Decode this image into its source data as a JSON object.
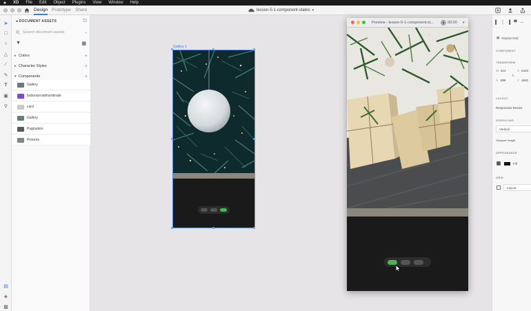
{
  "menubar": {
    "app": "XD",
    "items": [
      "File",
      "Edit",
      "Object",
      "Plugins",
      "View",
      "Window",
      "Help"
    ]
  },
  "titlebar": {
    "tabs": [
      "Design",
      "Prototype",
      "Share"
    ],
    "active_tab": "Design",
    "document_title": "lesson-5-1-component-states"
  },
  "assets": {
    "header": "DOCUMENT ASSETS",
    "search_placeholder": "Search document assets",
    "sections": [
      "Colors",
      "Character Styles",
      "Components"
    ],
    "components": [
      {
        "label": "Gallery",
        "thumb": "#6b7a74"
      },
      {
        "label": "buttonarrowthumbnale",
        "thumb": "#7b4bd6"
      },
      {
        "label": "card",
        "thumb": "#c9c9c9"
      },
      {
        "label": "Gallery",
        "thumb": "#6b7a74"
      },
      {
        "label": "Pagination",
        "thumb": "#5a5a5a"
      },
      {
        "label": "Pictures",
        "thumb": "#7d8784"
      }
    ]
  },
  "canvas": {
    "artboard_label": "Gallery 1"
  },
  "preview": {
    "title": "Preview - lesson-5-1-component-st...",
    "time": "00:00"
  },
  "props": {
    "repeat_grid": "Repeat Grid",
    "component_label": "COMPONENT",
    "transform_label": "TRANSFORM",
    "w": "414",
    "x": "5423",
    "h": "896",
    "y": "1840",
    "layout_label": "LAYOUT",
    "responsive_resize": "Responsive Resize",
    "scrolling_label": "SCROLLING",
    "scroll_value": "Vertical",
    "viewport_height": "Viewport Height",
    "appearance_label": "APPEARANCE",
    "fill_label": "Fill",
    "grid_label": "GRID",
    "grid_value": "Layout"
  },
  "colors": {
    "accent": "#2d7df6",
    "pagination_active": "#3fb950"
  }
}
